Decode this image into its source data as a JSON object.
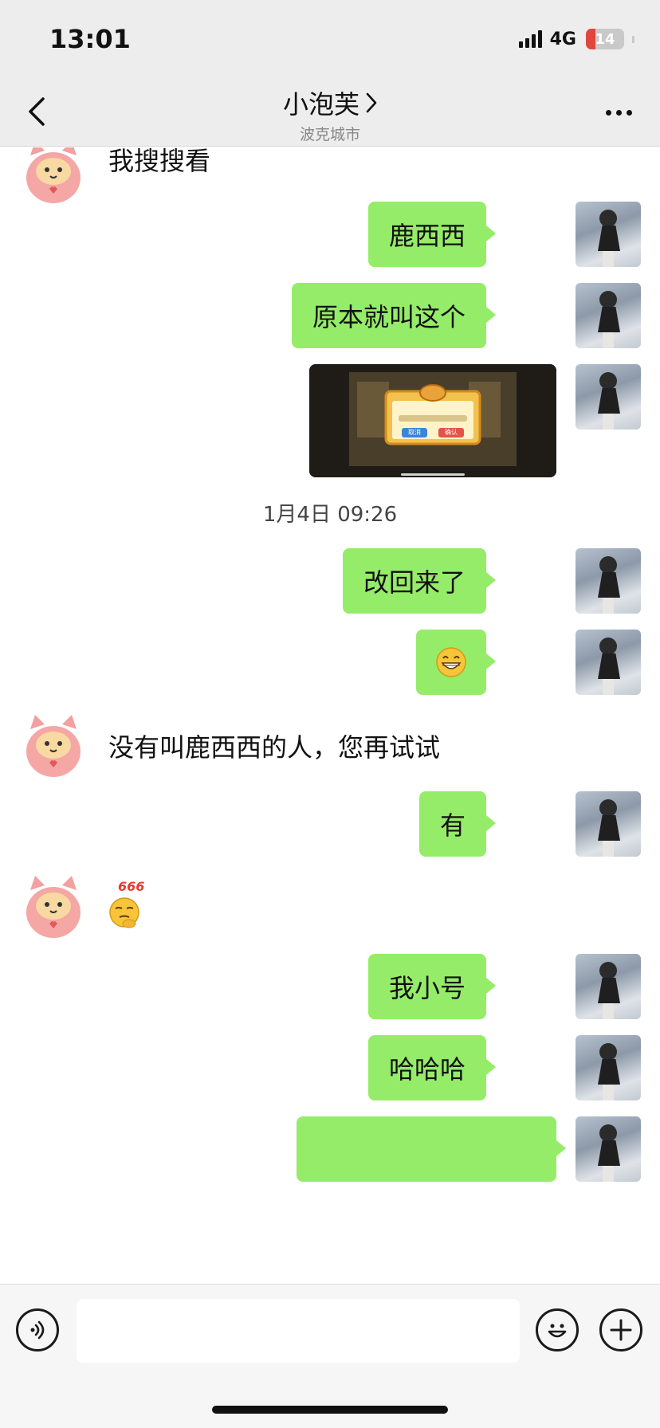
{
  "status_bar": {
    "time": "13:01",
    "network": "4G",
    "battery_level": "14",
    "battery_fraction": 0.14,
    "icons": [
      "signal-icon",
      "battery-icon"
    ]
  },
  "nav": {
    "title": "小泡芙",
    "subtitle": "波克城市",
    "icons": [
      "back-icon",
      "chevron-right-icon",
      "more-icon"
    ]
  },
  "messages": [
    {
      "from": "other",
      "type": "text",
      "text": "我搜搜看"
    },
    {
      "from": "self",
      "type": "text",
      "text": "鹿西西"
    },
    {
      "from": "self",
      "type": "text",
      "text": "原本就叫这个"
    },
    {
      "from": "self",
      "type": "image",
      "content": "game-screenshot",
      "dialog_buttons": [
        "取消",
        "确认"
      ]
    },
    {
      "type": "timestamp",
      "text": "1月4日 09:26"
    },
    {
      "from": "self",
      "type": "text",
      "text": "改回来了"
    },
    {
      "from": "self",
      "type": "emoji",
      "emoji": "grin-emoji"
    },
    {
      "from": "other",
      "type": "text",
      "text": "没有叫鹿西西的人，您再试试"
    },
    {
      "from": "self",
      "type": "text",
      "text": "有"
    },
    {
      "from": "other",
      "type": "sticker",
      "sticker": "666-thinking-emoji",
      "badge": "666"
    },
    {
      "from": "self",
      "type": "text",
      "text": "我小号"
    },
    {
      "from": "self",
      "type": "text",
      "text": "哈哈哈"
    }
  ],
  "input_bar": {
    "placeholder": "",
    "icons": [
      "voice-icon",
      "emoji-icon",
      "plus-icon"
    ]
  }
}
